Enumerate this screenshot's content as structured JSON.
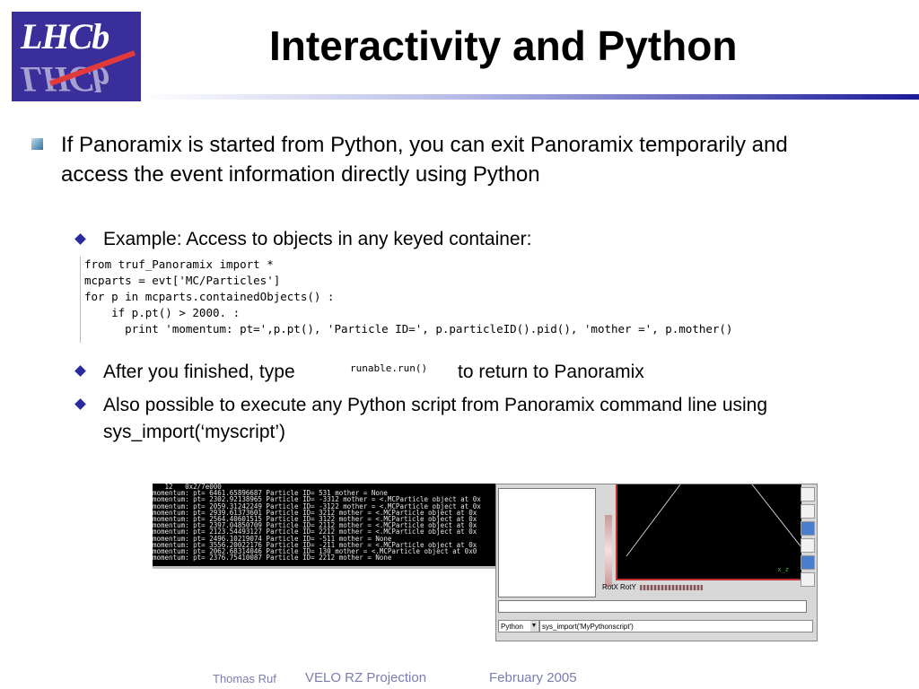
{
  "logo": {
    "top": "LHCb",
    "bottom": "LHCb"
  },
  "title": "Interactivity and Python",
  "bullet1": "If Panoramix is started from Python, you can exit Panoramix temporarily and access the event information directly using Python",
  "sub1": "Example: Access to objects in any keyed container:",
  "code": {
    "line1": "from truf_Panoramix import *",
    "line2": "mcparts = evt['MC/Particles']",
    "line3": "for p in mcparts.containedObjects() :",
    "line4": "    if p.pt() > 2000. :",
    "line5": "      print 'momentum: pt=',p.pt(), 'Particle ID=', p.particleID().pid(), 'mother =', p.mother()"
  },
  "sub2": {
    "before": "After you finished, type",
    "code": "runable.run()",
    "after": "to return to Panoramix"
  },
  "sub3": "Also possible to execute any Python script from Panoramix command line using sys_import(‘myscript’)",
  "terminal_lines": [
    "   12   0x2/7e000",
    "momentum: pt= 6461.65896687 Particle ID= 531 mother = None",
    "momentum: pt= 2302.92138965 Particle ID= -3312 mother = <.MCParticle object at 0x",
    "momentum: pt= 2059.31242249 Particle ID= -3122 mother = <.MCParticle object at 0x",
    "momentum: pt= 2939.61373601 Particle ID= 3212 mother = <.MCParticle object at 0x",
    "momentum: pt= 2564.40601515 Particle ID= 3122 mother = <.MCParticle object at 0x",
    "momentum: pt= 2397.04850709 Particle ID= 2112 mother = <.MCParticle object at 0x",
    "momentum: pt= 2123.54493127 Particle ID= 2212 mother = <.MCParticle object at 0x",
    "momentum: pt= 2496.10219074 Particle ID= -511 mother = None",
    "momentum: pt= 3556.20022176 Particle ID= -211 mother = <.MCParticle object at 0x",
    "momentum: pt= 2062.68314046 Particle ID= 130 mother = <.MCParticle object at 0x0",
    "momentum: pt= 2376.75410087 Particle ID= 2212 mother = None"
  ],
  "panoramix": {
    "dials_label": "RotX RotY",
    "axis_label": "x_z",
    "select_value": "Python",
    "command_value": "sys_import('MyPythonscript')"
  },
  "footer": {
    "author": "Thomas Ruf",
    "topic": "VELO RZ Projection",
    "date": "February  2005"
  }
}
